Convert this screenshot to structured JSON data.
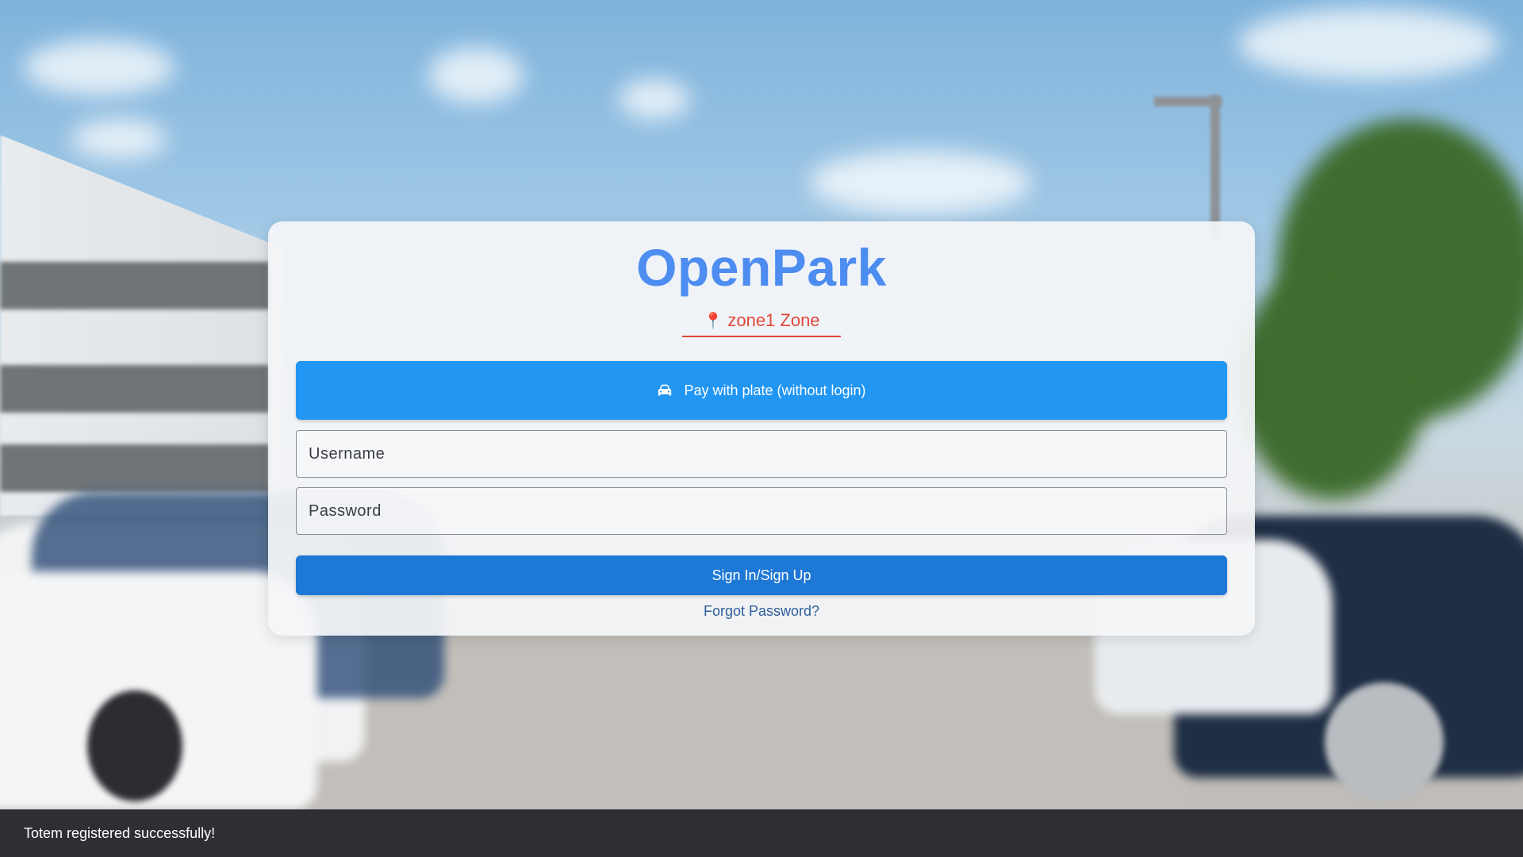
{
  "app": {
    "title": "OpenPark",
    "zone_icon": "pin-icon",
    "zone_label": "zone1 Zone"
  },
  "actions": {
    "plate_icon": "car-icon",
    "plate_label": "Pay with plate (without login)",
    "signin_label": "Sign In/Sign Up",
    "forgot_label": "Forgot Password?"
  },
  "form": {
    "username_placeholder": "Username",
    "password_placeholder": "Password"
  },
  "snackbar": {
    "message": "Totem registered successfully!"
  },
  "colors": {
    "title": "#4d8cf0",
    "zone": "#e0493b",
    "plate_button": "#2196f3",
    "signin_button": "#1e78d6",
    "link": "#2d5f9a",
    "snackbar": "#2d2f33"
  }
}
